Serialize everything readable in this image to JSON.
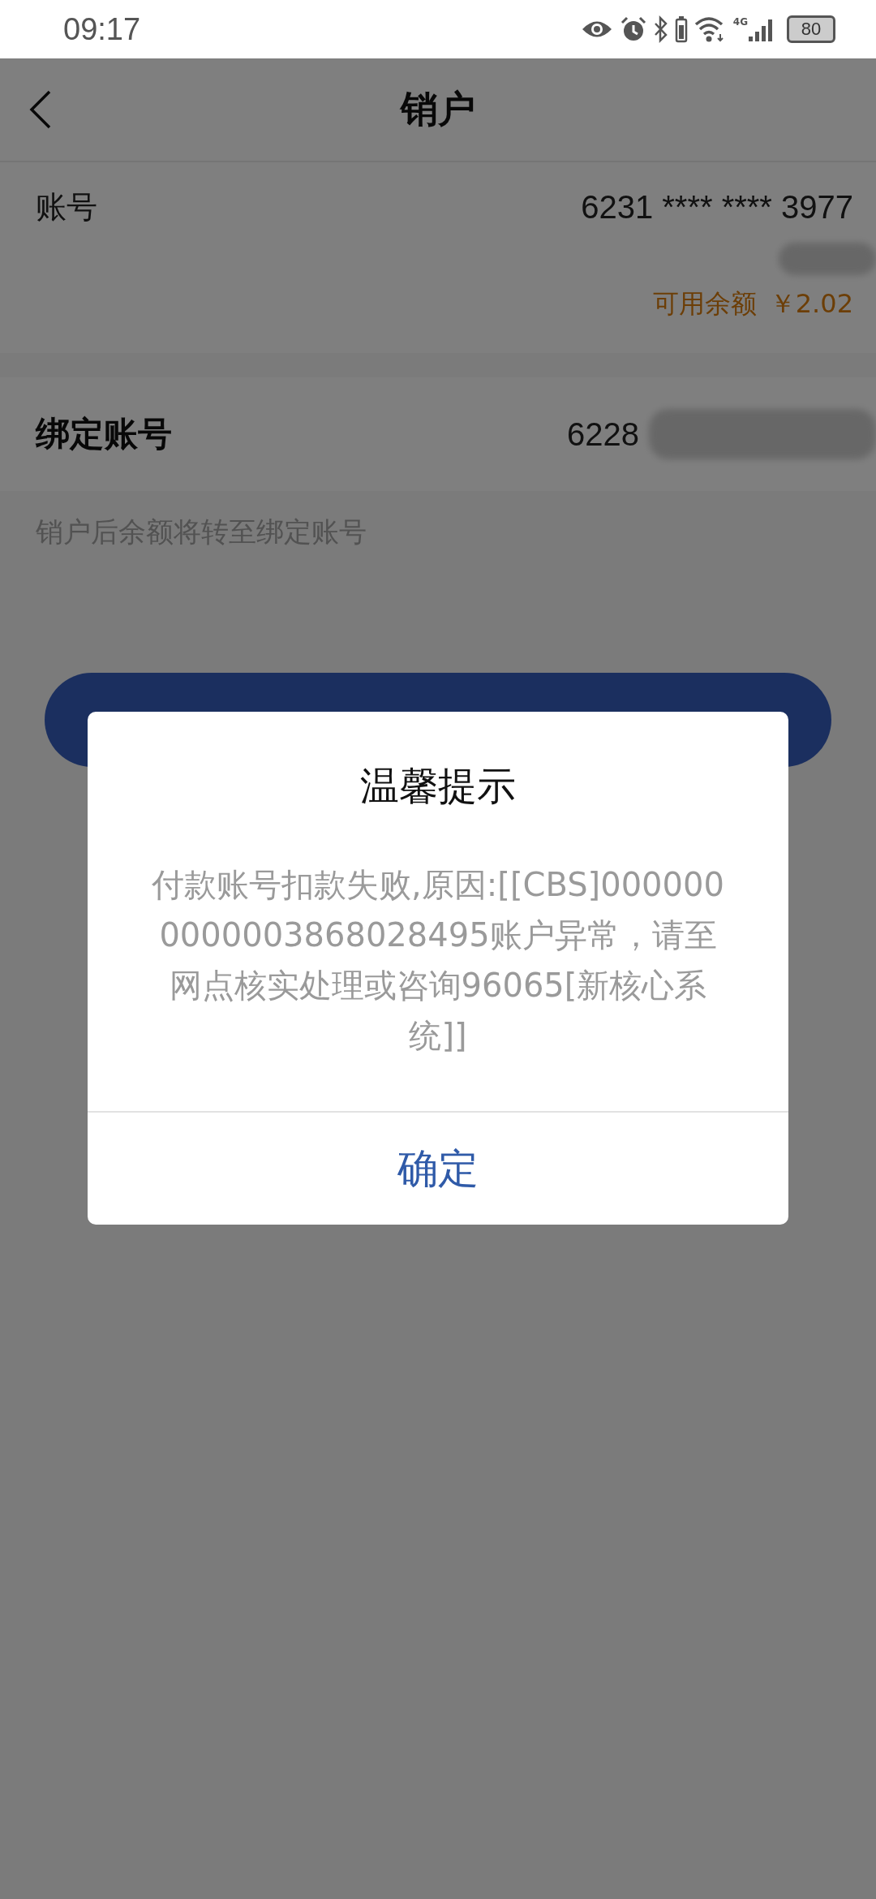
{
  "status_bar": {
    "time": "09:17",
    "network": "4G",
    "battery": "80"
  },
  "nav": {
    "title": "销户"
  },
  "account": {
    "label": "账号",
    "value": "6231 **** **** 3977",
    "balance_label": "可用余额",
    "balance": "￥2.02"
  },
  "bound_account": {
    "label": "绑定账号",
    "value": "6228"
  },
  "hint": "销户后余额将转至绑定账号",
  "submit_button": {
    "kind": "pill"
  },
  "dialog": {
    "title": "温馨提示",
    "message": "付款账号扣款失败,原因:[[CBS]0000000000003868028495账户异常，请至网点核实处理或咨询96065[新核心系统]]",
    "confirm": "确定"
  }
}
